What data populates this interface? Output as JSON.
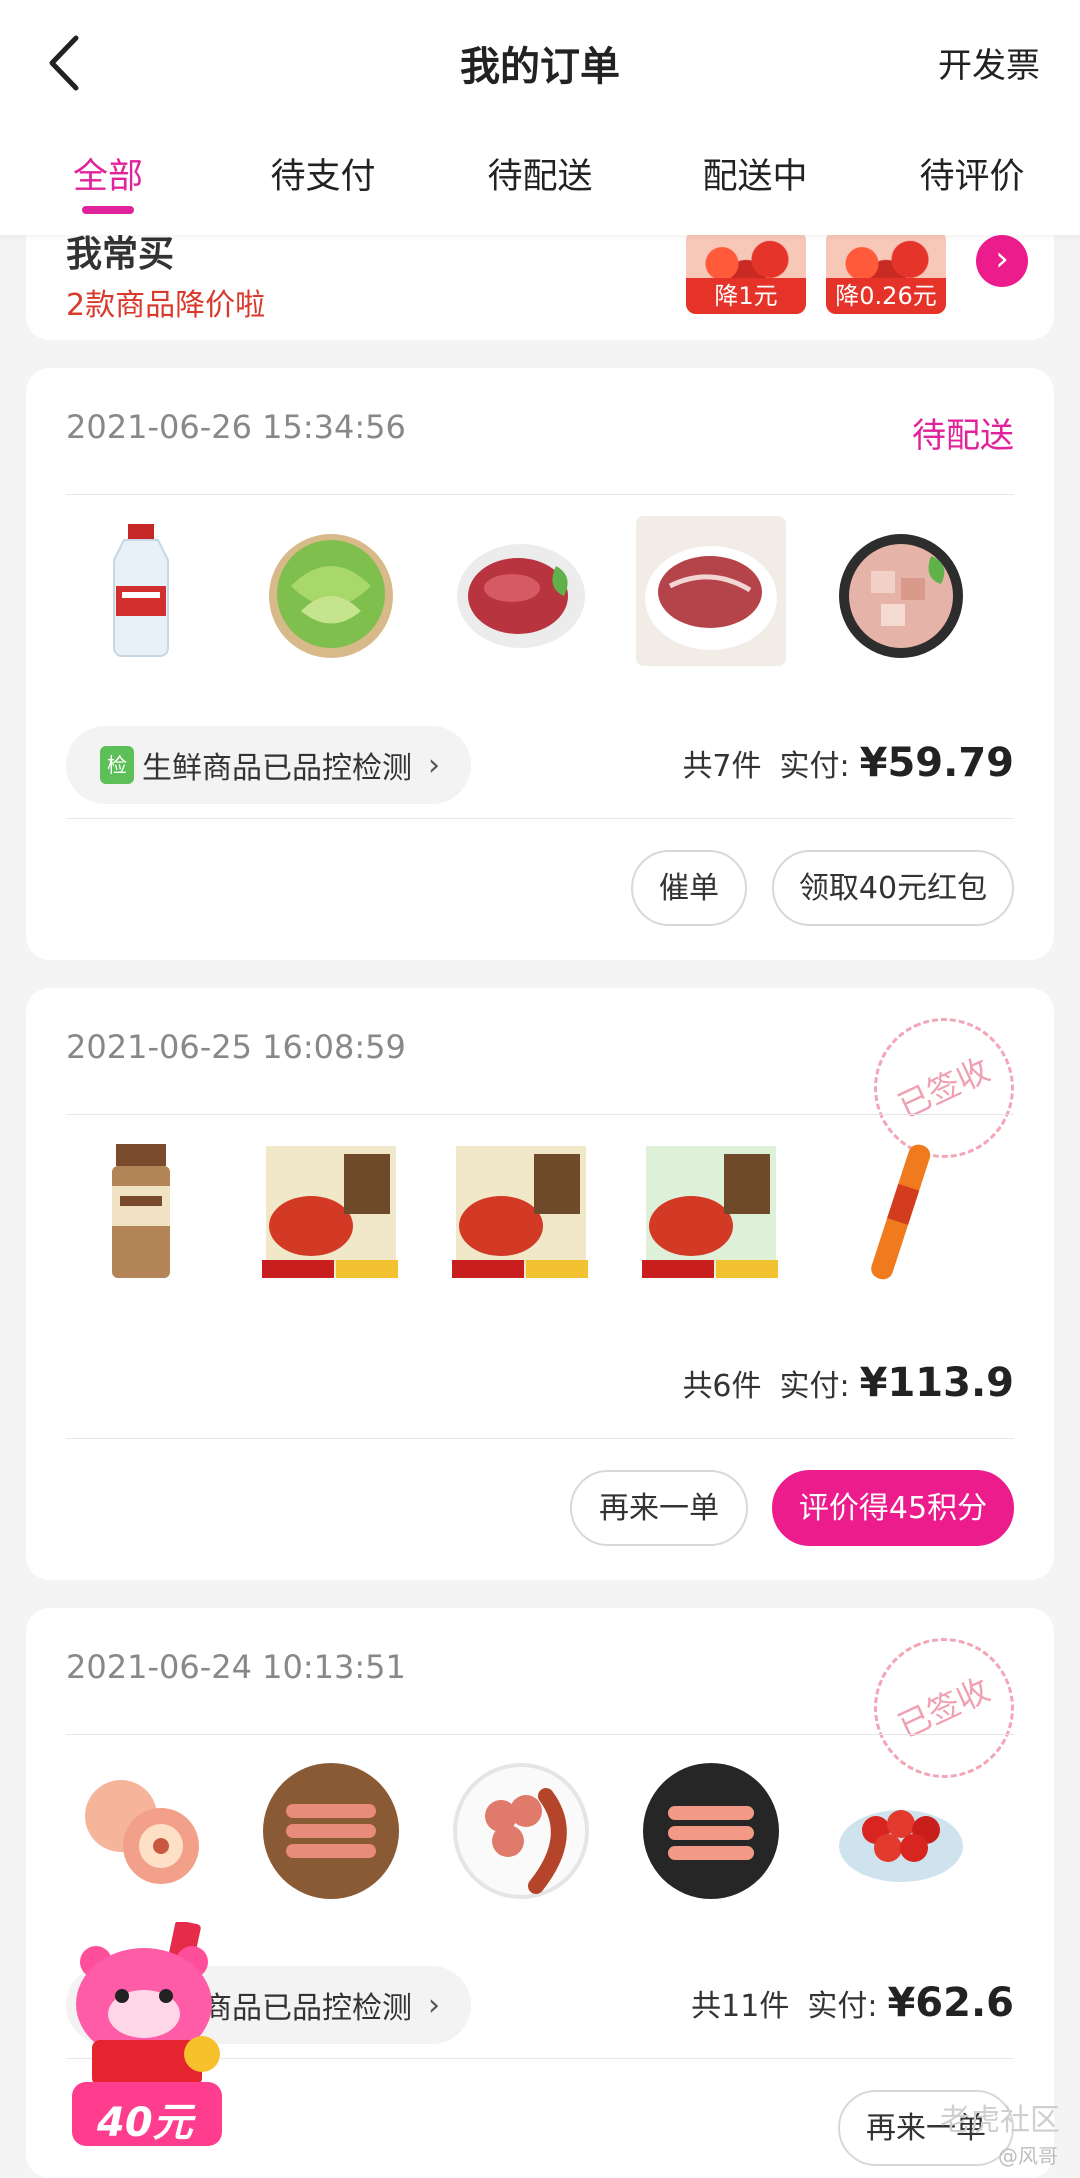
{
  "header": {
    "title": "我的订单",
    "invoice_label": "开发票",
    "tabs": [
      {
        "label": "全部"
      },
      {
        "label": "待支付"
      },
      {
        "label": "待配送"
      },
      {
        "label": "配送中"
      },
      {
        "label": "待评价"
      }
    ],
    "active_tab": 0
  },
  "promo": {
    "title": "我常买",
    "subtitle": "2款商品降价啦",
    "items": [
      {
        "badge": "降1元"
      },
      {
        "badge": "降0.26元"
      }
    ]
  },
  "orders": [
    {
      "date": "2021-06-26 15:34:56",
      "status": "待配送",
      "qc_label": "生鲜商品已品控检测",
      "qc_icon": "检",
      "count_text": "共7件",
      "paid_label": "实付:",
      "price": "¥59.79",
      "buttons": [
        "催单",
        "领取40元红包"
      ]
    },
    {
      "date": "2021-06-25 16:08:59",
      "stamp": "已签收",
      "count_text": "共6件",
      "paid_label": "实付:",
      "price": "¥113.9",
      "buttons": [
        "再来一单",
        "评价得45积分"
      ]
    },
    {
      "date": "2021-06-24 10:13:51",
      "stamp": "已签收",
      "qc_label": "生鲜商品已品控检测",
      "count_text": "共11件",
      "paid_label": "实付:",
      "price": "¥62.6",
      "buttons": [
        "再来一单"
      ]
    }
  ],
  "floating_coupon": {
    "amount": "40元"
  },
  "watermark": {
    "main": "老虎社区",
    "sub": "@风哥"
  },
  "colors": {
    "accent": "#e0229b",
    "button_primary": "#ec1c8c",
    "warning_red": "#d9392b"
  }
}
